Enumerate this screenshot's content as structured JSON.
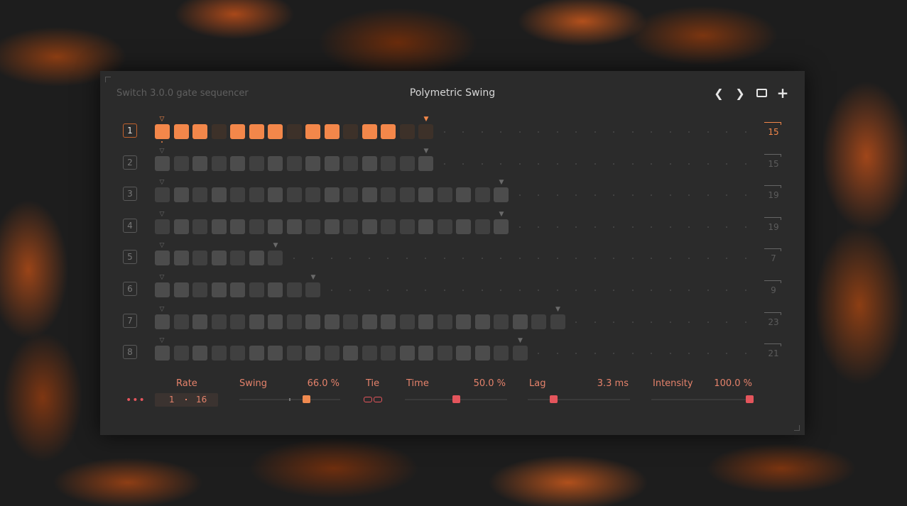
{
  "header": {
    "app_title": "Switch 3.0.0 gate sequencer",
    "preset_name": "Polymetric Swing",
    "prev_icon": "chevron-left-icon",
    "next_icon": "chevron-right-icon",
    "window_icon": "window-icon",
    "add_icon": "plus-icon"
  },
  "sequencer": {
    "active_row": 1,
    "rows": [
      {
        "num": "1",
        "length": "15",
        "steps": [
          1,
          1,
          1,
          0,
          1,
          1,
          1,
          0,
          1,
          1,
          0,
          1,
          1,
          0,
          0
        ]
      },
      {
        "num": "2",
        "length": "15",
        "steps": [
          1,
          0,
          1,
          0,
          1,
          0,
          1,
          0,
          1,
          1,
          0,
          1,
          0,
          0,
          1
        ]
      },
      {
        "num": "3",
        "length": "19",
        "steps": [
          0,
          1,
          0,
          1,
          0,
          0,
          1,
          0,
          0,
          1,
          0,
          1,
          0,
          0,
          1,
          0,
          1,
          0,
          1
        ]
      },
      {
        "num": "4",
        "length": "19",
        "steps": [
          0,
          1,
          0,
          1,
          1,
          0,
          1,
          1,
          0,
          1,
          0,
          1,
          0,
          0,
          1,
          0,
          1,
          0,
          1
        ]
      },
      {
        "num": "5",
        "length": "7",
        "steps": [
          1,
          1,
          0,
          1,
          0,
          1,
          0
        ]
      },
      {
        "num": "6",
        "length": "9",
        "steps": [
          1,
          1,
          0,
          1,
          1,
          0,
          1,
          0,
          0
        ]
      },
      {
        "num": "7",
        "length": "23",
        "steps": [
          1,
          0,
          1,
          0,
          0,
          1,
          1,
          0,
          1,
          1,
          0,
          1,
          1,
          0,
          1,
          0,
          1,
          1,
          0,
          1,
          0,
          0
        ]
      },
      {
        "num": "8",
        "length": "21",
        "steps": [
          1,
          0,
          1,
          0,
          0,
          1,
          1,
          0,
          1,
          0,
          1,
          0,
          0,
          1,
          1,
          0,
          1,
          1,
          0,
          0
        ]
      }
    ]
  },
  "controls": {
    "more_label": "•••",
    "rate": {
      "label": "Rate",
      "numerator": "1",
      "denominator": "16"
    },
    "swing": {
      "label": "Swing",
      "value": "66.0 %",
      "level": 0.66
    },
    "tie": {
      "label": "Tie",
      "icon": "link-icon"
    },
    "time": {
      "label": "Time",
      "value": "50.0 %",
      "level": 0.5
    },
    "lag": {
      "label": "Lag",
      "value": "3.3 ms",
      "level": 0.25
    },
    "intensity": {
      "label": "Intensity",
      "value": "100.0 %",
      "level": 1.0
    }
  },
  "colors": {
    "accent_orange": "#f3874a",
    "accent_red": "#e4555c",
    "panel": "#2b2b2b"
  }
}
